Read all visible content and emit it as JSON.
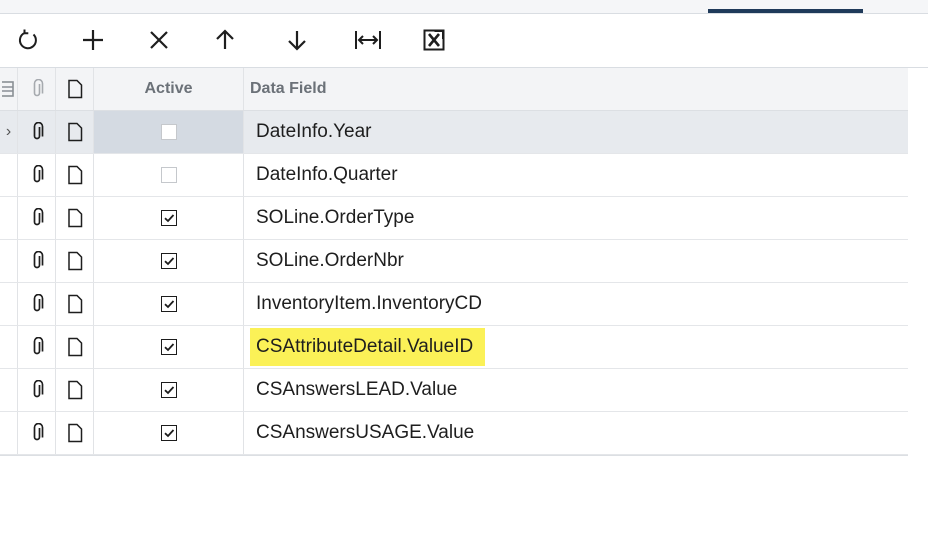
{
  "toolbar": {
    "buttons": [
      {
        "icon": "refresh-icon"
      },
      {
        "icon": "plus-icon"
      },
      {
        "icon": "close-icon"
      },
      {
        "icon": "arrow-up-icon"
      },
      {
        "icon": "arrow-down-icon"
      },
      {
        "icon": "fit-width-icon"
      },
      {
        "icon": "excel-export-icon"
      }
    ]
  },
  "grid": {
    "columns": {
      "active": "Active",
      "data_field": "Data Field"
    },
    "rows": [
      {
        "active": false,
        "field": "DateInfo.Year",
        "selected": true,
        "disabled": true
      },
      {
        "active": false,
        "field": "DateInfo.Quarter",
        "disabled": true
      },
      {
        "active": true,
        "field": "SOLine.OrderType"
      },
      {
        "active": true,
        "field": "SOLine.OrderNbr"
      },
      {
        "active": true,
        "field": "InventoryItem.InventoryCD"
      },
      {
        "active": true,
        "field": "CSAttributeDetail.ValueID",
        "highlighted": true
      },
      {
        "active": true,
        "field": "CSAnswersLEAD.Value"
      },
      {
        "active": true,
        "field": "CSAnswersUSAGE.Value"
      }
    ]
  },
  "colors": {
    "tab_indicator": "#1f3a5a",
    "selected_row": "#e7eaee",
    "highlight": "#fbf157",
    "header_bg": "#f3f4f6"
  }
}
